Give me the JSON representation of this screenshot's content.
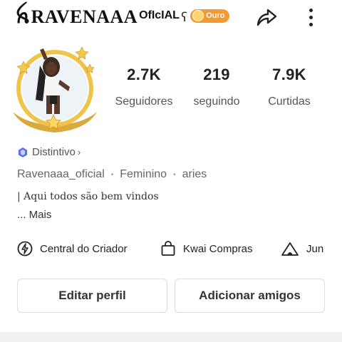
{
  "header": {
    "title_fancy": "ꫝRAVENAAA",
    "title_suffix": "OfIcIAL",
    "deco_mark": "ʕ",
    "badge_label": "Ouro"
  },
  "stats": [
    {
      "value": "2.7K",
      "label": "Seguidores"
    },
    {
      "value": "219",
      "label": "seguindo"
    },
    {
      "value": "7.9K",
      "label": "Curtidas"
    }
  ],
  "distintivo": {
    "label": "Distintivo",
    "chevron": "›"
  },
  "info": {
    "username": "Ravenaaa_oficial",
    "gender": "Feminino",
    "sign": "aries",
    "separator": "•"
  },
  "bio": {
    "line1": "| Aqui todos são bem vindos",
    "more": "... Mais"
  },
  "shortcuts": [
    {
      "label": "Central do Criador",
      "icon": "lightning-icon"
    },
    {
      "label": "Kwai Compras",
      "icon": "shopping-bag-icon"
    },
    {
      "label": "Jun",
      "icon": "tent-icon"
    }
  ],
  "buttons": {
    "edit": "Editar perfil",
    "add_friends": "Adicionar amigos"
  },
  "colors": {
    "badge_orange": "#f39a33",
    "avatar_gold": "#e0b43a",
    "distintivo_blue": "#5b6ff0"
  }
}
